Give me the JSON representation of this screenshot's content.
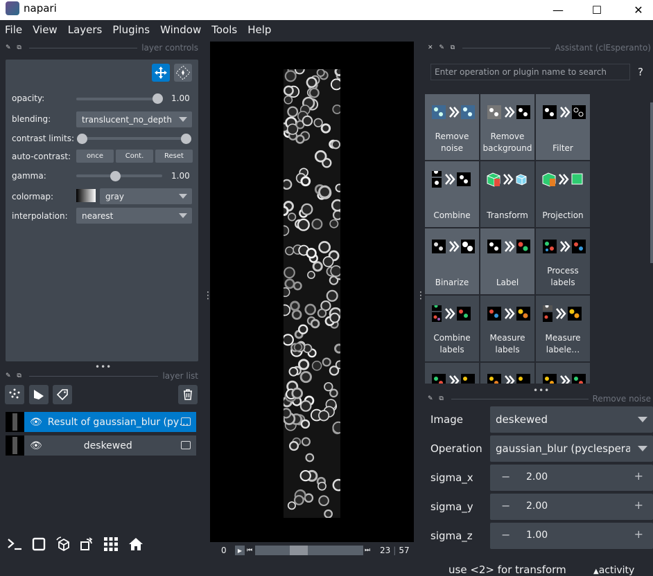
{
  "window": {
    "title": "napari",
    "minimize": "—",
    "maximize": "☐",
    "close": "✕"
  },
  "menu": [
    "File",
    "View",
    "Layers",
    "Plugins",
    "Window",
    "Tools",
    "Help"
  ],
  "layer_controls": {
    "header": "layer controls",
    "opacity_label": "opacity:",
    "opacity_value": "1.00",
    "blending_label": "blending:",
    "blending_value": "translucent_no_depth",
    "contrast_label": "contrast limits:",
    "autocontrast_label": "auto-contrast:",
    "autocontrast_buttons": [
      "once",
      "Cont.",
      "Reset"
    ],
    "gamma_label": "gamma:",
    "gamma_value": "1.00",
    "colormap_label": "colormap:",
    "colormap_value": "gray",
    "interpolation_label": "interpolation:",
    "interpolation_value": "nearest"
  },
  "layer_list": {
    "header": "layer list",
    "layers": [
      {
        "name": "Result of gaussian_blur (py…",
        "selected": true
      },
      {
        "name": "deskewed",
        "selected": false
      }
    ]
  },
  "dims": {
    "start": "0",
    "current": "23",
    "max": "57"
  },
  "assistant": {
    "header": "Assistant (clEsperanto)",
    "search_placeholder": "Enter operation or plugin name to search",
    "help": "?",
    "tiles": [
      {
        "label": "Remove noise"
      },
      {
        "label": "Remove background"
      },
      {
        "label": "Filter"
      },
      {
        "label": "Combine"
      },
      {
        "label": "Transform"
      },
      {
        "label": "Projection"
      },
      {
        "label": "Binarize"
      },
      {
        "label": "Label"
      },
      {
        "label": "Process labels"
      },
      {
        "label": "Combine labels"
      },
      {
        "label": "Measure labels"
      },
      {
        "label": "Measure labele…"
      }
    ]
  },
  "remove_noise": {
    "header": "Remove noise",
    "image_label": "Image",
    "image_value": "deskewed",
    "operation_label": "Operation",
    "operation_value": "gaussian_blur (pyclesperanto)",
    "params": [
      {
        "label": "sigma_x",
        "value": "2.00"
      },
      {
        "label": "sigma_y",
        "value": "2.00"
      },
      {
        "label": "sigma_z",
        "value": "1.00"
      }
    ]
  },
  "status": {
    "message": "use <2> for transform",
    "activity": "activity"
  }
}
